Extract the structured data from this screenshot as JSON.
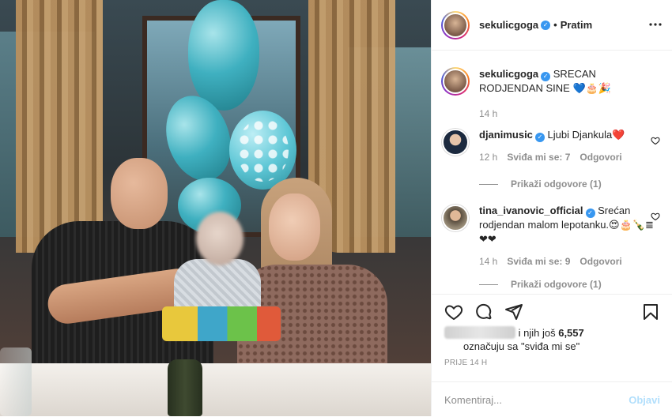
{
  "header": {
    "username": "sekulicgoga",
    "separator": "•",
    "follow_label": "Pratim"
  },
  "caption": {
    "username": "sekulicgoga",
    "text": "SRECAN RODJENDAN SINE 💙🎂🎉",
    "time": "14 h"
  },
  "comments": [
    {
      "username": "djanimusic",
      "text": "Ljubi Djankula❤️",
      "time": "12 h",
      "likes": "Sviđa mi se: 7",
      "reply": "Odgovori",
      "view_replies": "Prikaži odgovore (1)"
    },
    {
      "username": "tina_ivanovic_official",
      "text": "Srećan rodjendan malom lepotanku.😍🎂🍾≣❤❤",
      "time": "14 h",
      "likes": "Sviđa mi se: 9",
      "reply": "Odgovori",
      "view_replies": "Prikaži odgovore (1)"
    }
  ],
  "likes": {
    "prefix": "i njih još",
    "count": "6,557",
    "suffix": "označuju sa \"sviđa mi se\""
  },
  "age": "PRIJE 14 H",
  "add_comment": {
    "placeholder": "Komentiraj...",
    "post_label": "Objavi"
  },
  "colors": {
    "verified": "#3897f0",
    "post_button_disabled": "#b2dffc",
    "secondary_text": "#8e8e8e"
  },
  "icons": [
    "more-icon",
    "heart-icon",
    "comment-icon",
    "share-icon",
    "save-icon",
    "verified-icon"
  ]
}
